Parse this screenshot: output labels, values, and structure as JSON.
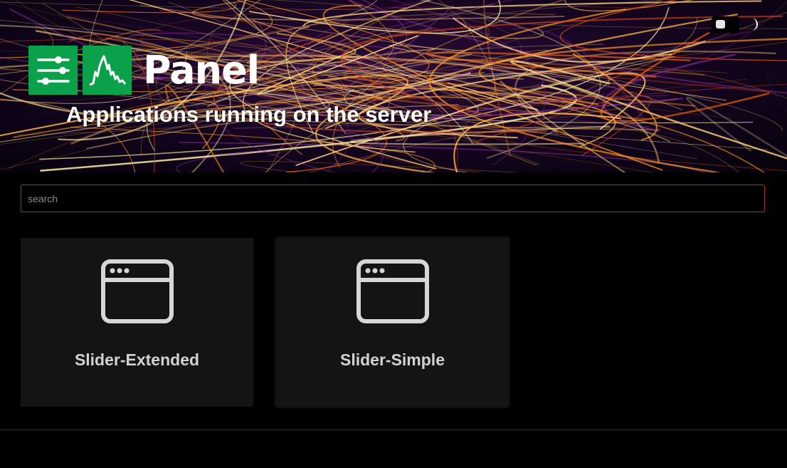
{
  "header": {
    "brand_name": "Panel",
    "subtitle": "Applications running on the server",
    "logo_color": "#0aa14a",
    "icons": [
      "sliders-icon",
      "line-chart-icon",
      "moon-icon"
    ]
  },
  "theme_toggle": {
    "mode": "dark"
  },
  "search": {
    "placeholder": "search",
    "value": "",
    "border_color": "#b02a4a"
  },
  "apps": [
    {
      "label": "Slider-Extended",
      "icon": "browser-window-icon"
    },
    {
      "label": "Slider-Simple",
      "icon": "browser-window-icon"
    }
  ]
}
